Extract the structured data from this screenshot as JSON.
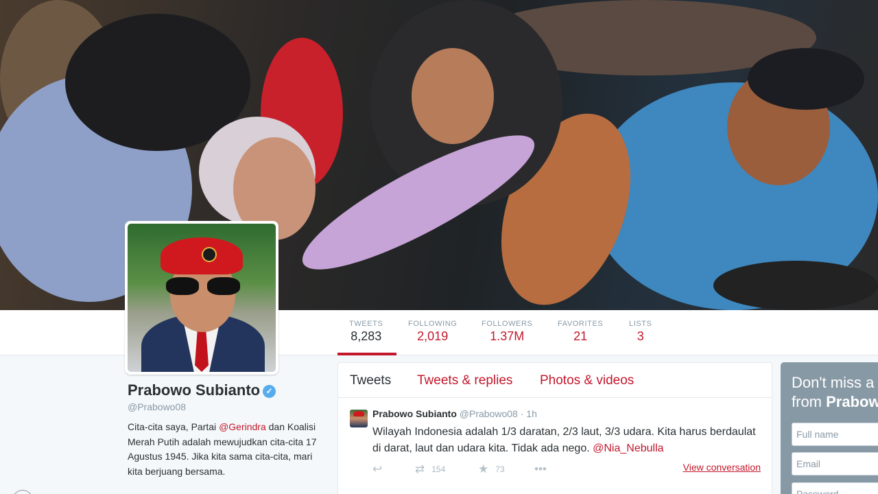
{
  "profile": {
    "name": "Prabowo Subianto",
    "handle": "@Prabowo08",
    "bio_parts": {
      "p1": "Cita-cita saya, Partai ",
      "link": "@Gerindra",
      "p2": " dan Koalisi Merah Putih adalah mewujudkan cita-cita 17 Agustus 1945. Jika kita sama cita-cita, mari kita berjuang bersama."
    },
    "verified_glyph": "✓"
  },
  "stats": [
    {
      "label": "TWEETS",
      "value": "8,283"
    },
    {
      "label": "FOLLOWING",
      "value": "2,019"
    },
    {
      "label": "FOLLOWERS",
      "value": "1.37M"
    },
    {
      "label": "FAVORITES",
      "value": "21"
    },
    {
      "label": "LISTS",
      "value": "3"
    }
  ],
  "timeline": {
    "tabs": [
      "Tweets",
      "Tweets & replies",
      "Photos & videos"
    ],
    "tweet": {
      "name": "Prabowo Subianto",
      "handle": "@Prabowo08",
      "separator": "·",
      "time": "1h",
      "text": "Wilayah Indonesia adalah 1/3 daratan, 2/3 laut, 3/3 udara. Kita harus berdaulat di darat, laut dan udara kita. Tidak ada nego. ",
      "mention": "@Nia_Nebulla",
      "retweets": "154",
      "favorites": "73",
      "view_conversation": "View conversation"
    }
  },
  "signup": {
    "title_line1": "Don't miss a",
    "title_prefix": "from ",
    "title_name": "Prabowo",
    "fullname_placeholder": "Full name",
    "email_placeholder": "Email",
    "password_placeholder": "Password"
  },
  "icons": {
    "reply": "reply-icon",
    "retweet": "retweet-icon",
    "favorite": "star-icon",
    "more": "more-icon"
  },
  "colors": {
    "link": "#c2172b",
    "verified": "#55acee",
    "muted": "#8899a6"
  }
}
